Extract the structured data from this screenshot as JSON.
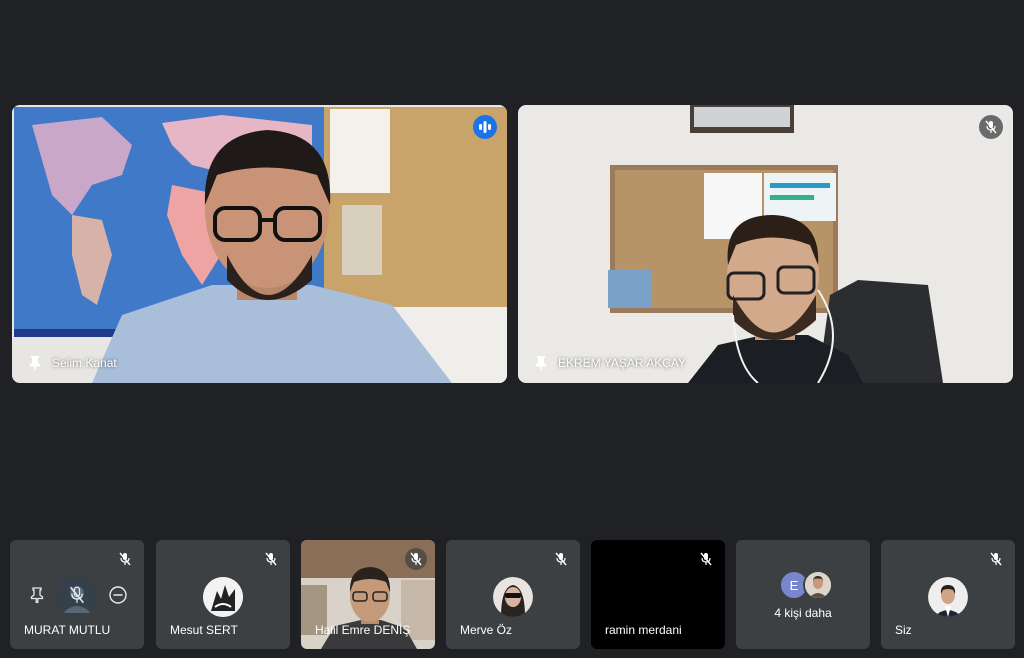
{
  "main_participants": [
    {
      "name": "Selim Kanat",
      "state": "speaking"
    },
    {
      "name": "EKREM YAŞAR AKÇAY",
      "state": "muted"
    }
  ],
  "strip": [
    {
      "name": "MURAT MUTLU",
      "muted": true
    },
    {
      "name": "Mesut SERT",
      "muted": true
    },
    {
      "name": "Halil Emre DENİŞ",
      "muted": true
    },
    {
      "name": "Merve Öz",
      "muted": true
    },
    {
      "name": "ramin merdani",
      "muted": true
    },
    {
      "more_label": "4 kişi daha",
      "initial": "E"
    },
    {
      "name": "Siz",
      "muted": true
    }
  ],
  "colors": {
    "background": "#202124",
    "tile": "#3c4043",
    "active_speaker_border": "#8ab4f8",
    "speaking_badge": "#1a73e8",
    "initial_avatar": "#7986cb"
  }
}
